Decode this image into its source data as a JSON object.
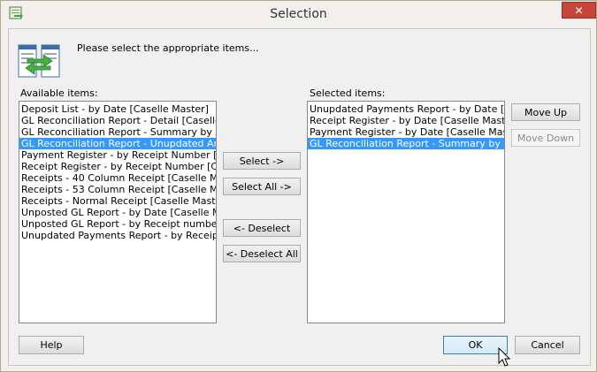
{
  "window": {
    "title": "Selection",
    "close_glyph": "✕",
    "app_icon": "app-icon"
  },
  "header": {
    "icon": "swap-lists-icon",
    "prompt": "Please select the appropriate items..."
  },
  "available": {
    "label": "Available items:",
    "items": [
      {
        "label": "Deposit List - by Date [Caselle Master]",
        "selected": false
      },
      {
        "label": "GL Reconciliation Report - Detail [Caselle Mast",
        "selected": false
      },
      {
        "label": "GL Reconciliation Report - Summary by Accour",
        "selected": false
      },
      {
        "label": "GL Reconciliation Report - Unupdated Amount",
        "selected": true
      },
      {
        "label": "Payment Register - by Receipt Number [Caselle",
        "selected": false
      },
      {
        "label": "Receipt Register - by Receipt Number [Caselle",
        "selected": false
      },
      {
        "label": "Receipts - 40 Column Receipt [Caselle Master]",
        "selected": false
      },
      {
        "label": "Receipts - 53 Column Receipt [Caselle Master]",
        "selected": false
      },
      {
        "label": "Receipts - Normal Receipt [Caselle Master]",
        "selected": false
      },
      {
        "label": "Unposted GL Report - by Date [Caselle Maste",
        "selected": false
      },
      {
        "label": "Unposted GL Report - by Receipt number [Cas",
        "selected": false
      },
      {
        "label": "Unupdated Payments Report - by Receipt Nur",
        "selected": false
      }
    ]
  },
  "selected": {
    "label": "Selected items:",
    "items": [
      {
        "label": "Unupdated Payments Report - by Date [Case",
        "selected": false
      },
      {
        "label": "Receipt Register - by Date [Caselle Master]",
        "selected": false
      },
      {
        "label": "Payment Register - by Date [Caselle Master]",
        "selected": false
      },
      {
        "label": "GL Reconciliation Report - Summary by Date [",
        "selected": true
      }
    ]
  },
  "buttons": {
    "select": "Select ->",
    "select_all": "Select All ->",
    "deselect": "<- Deselect",
    "deselect_all": "<- Deselect All",
    "move_up": "Move Up",
    "move_down": "Move Down",
    "help": "Help",
    "ok": "OK",
    "cancel": "Cancel"
  },
  "colors": {
    "selection": "#3399ff",
    "close_button": "#c7463c"
  }
}
